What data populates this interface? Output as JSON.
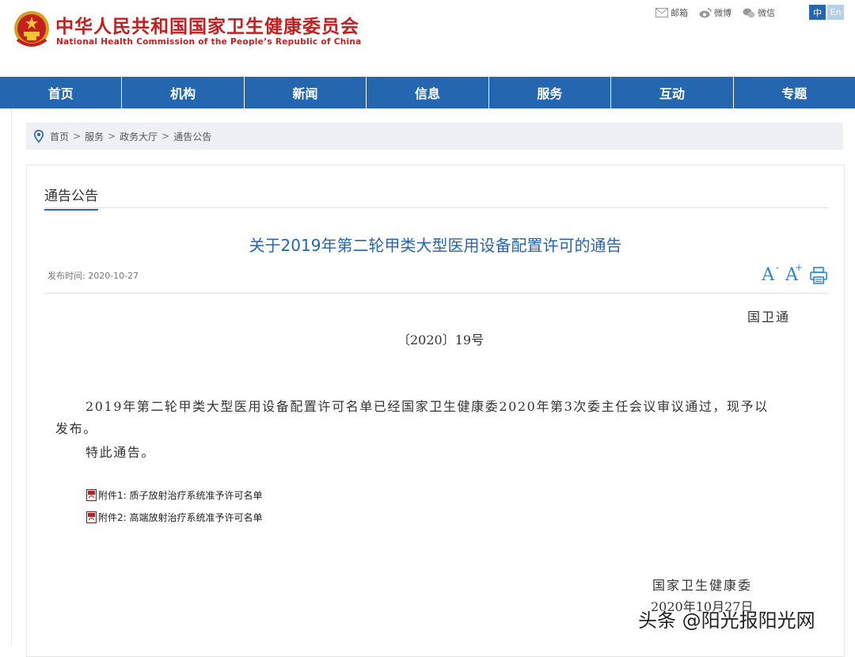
{
  "header": {
    "org_name_cn": "中华人民共和国国家卫生健康委员会",
    "org_name_en": "National Health Commission of the People’s Republic of China",
    "links": [
      {
        "label": "邮箱",
        "icon": "mail-icon"
      },
      {
        "label": "微博",
        "icon": "weibo-icon"
      },
      {
        "label": "微信",
        "icon": "wechat-icon"
      }
    ],
    "lang_zh": "中",
    "lang_en": "En"
  },
  "nav": {
    "items": [
      "首页",
      "机构",
      "新闻",
      "信息",
      "服务",
      "互动",
      "专题"
    ]
  },
  "breadcrumb": {
    "items": [
      "首页",
      "服务",
      "政务大厅",
      "通告公告"
    ],
    "separator": ">"
  },
  "section": {
    "title": "通告公告"
  },
  "article": {
    "title": "关于2019年第二轮甲类大型医用设备配置许可的通告",
    "pub_date": "发布时间:  2020-10-27",
    "font_larger": "A",
    "font_smaller": "A",
    "doc_number_a": "国卫通",
    "doc_number_b": "〔2020〕19号",
    "para1_line1": "2019年第二轮甲类大型医用设备配置许可名单已经国家卫生健康委2020年第3次委主任会议审议通过，现予以",
    "para1_line2": "发布。",
    "para2": "特此通告。",
    "attachments": [
      "附件1:  质子放射治疗系统准予许可名单",
      "附件2:  高端放射治疗系统准予许可名单"
    ],
    "signature_org": "国家卫生健康委",
    "signature_date": "2020年10月27日"
  },
  "watermark": "头条 @阳光报阳光网",
  "colors": {
    "brand_red": "#c21f1f",
    "nav_blue": "#2466b0",
    "title_blue": "#2466b0",
    "tool_blue": "#2c86d3"
  }
}
